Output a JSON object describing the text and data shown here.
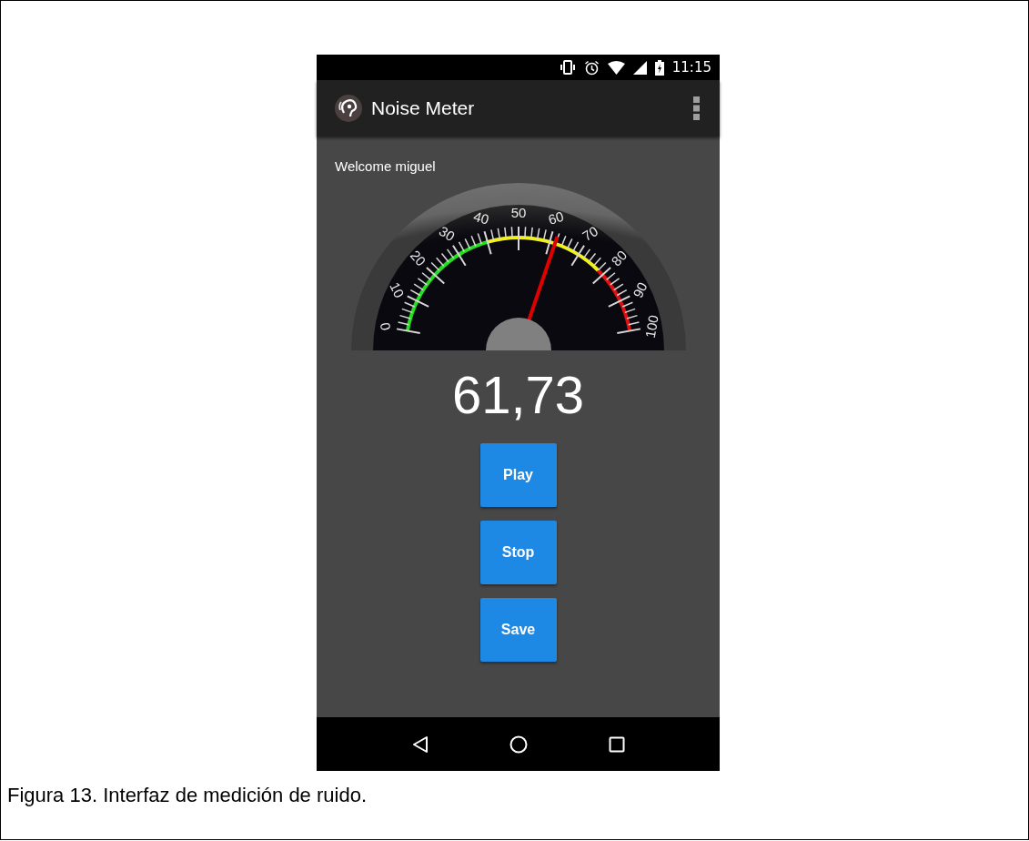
{
  "status_bar": {
    "time": "11:15"
  },
  "app_bar": {
    "title": "Noise Meter"
  },
  "welcome": "Welcome miguel",
  "gauge": {
    "scale_labels": [
      "0",
      "10",
      "20",
      "30",
      "40",
      "50",
      "60",
      "70",
      "80",
      "90",
      "100"
    ],
    "level": 0.6173
  },
  "reading": "61,73",
  "buttons": [
    "Play",
    "Stop",
    "Save"
  ],
  "caption": "Figura 13. Interfaz de medición de ruido."
}
